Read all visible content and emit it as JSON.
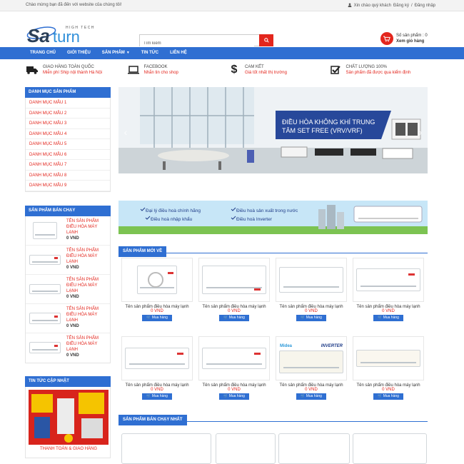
{
  "topbar": {
    "welcome": "Chào mừng bạn đã đến với website của chúng tôi!",
    "greeting": "Xin chào quý khách",
    "register": "Đăng ký",
    "separator": "/",
    "login": "Đăng nhập"
  },
  "header": {
    "logo_text": "Saturn",
    "logo_tagline": "HIGH TECH",
    "search_placeholder": "Tìm kiếm",
    "cart_count_label": "Số sản phẩm : 0",
    "cart_view": "Xem giỏ hàng"
  },
  "nav": {
    "items": [
      "TRANG CHỦ",
      "GIỚI THIỆU",
      "SẢN PHẨM",
      "TIN TỨC",
      "LIÊN HỆ"
    ]
  },
  "features": [
    {
      "title": "GIAO HÀNG TOÀN QUỐC",
      "sub": "Miễn phí Ship nội thành Hà Nội",
      "icon": "truck-icon"
    },
    {
      "title": "FACEBOOK",
      "sub": "Nhắn tin cho shop",
      "icon": "laptop-icon"
    },
    {
      "title": "CAM KẾT",
      "sub": "Giá tốt nhất thị trường",
      "icon": "dollar-icon"
    },
    {
      "title": "CHẤT LƯỢNG 100%",
      "sub": "Sản phẩm đã được qua kiểm định",
      "icon": "checkbox-icon"
    }
  ],
  "sidebar": {
    "categories_title": "DANH MỤC SẢN PHẨM",
    "categories": [
      "DANH MỤC MẪU 1",
      "DANH MỤC MẪU 2",
      "DANH MỤC MẪU 3",
      "DANH MỤC MẪU 4",
      "DANH MỤC MẪU 5",
      "DANH MỤC MẪU 6",
      "DANH MỤC MẪU 7",
      "DANH MỤC MẪU 8",
      "DANH MỤC MẪU 9"
    ],
    "bestseller_title": "SẢN PHẨM BÁN CHẠY",
    "bestsellers": [
      {
        "name": "TÊN SẢN PHẨM ĐIỀU HÒA MÁY LẠNH",
        "price": "0 VND"
      },
      {
        "name": "TÊN SẢN PHẨM ĐIỀU HÒA MÁY LẠNH",
        "price": "0 VND"
      },
      {
        "name": "TÊN SẢN PHẨM ĐIỀU HÒA MÁY LẠNH",
        "price": "0 VND"
      },
      {
        "name": "TÊN SẢN PHẨM ĐIỀU HÒA MÁY LẠNH",
        "price": "0 VND"
      },
      {
        "name": "TÊN SẢN PHẨM ĐIỀU HÒA MÁY LẠNH",
        "price": "0 VND"
      }
    ],
    "news_title": "TIN TỨC CẬP NHẬT",
    "news_caption": "THANH TOÁN & GIAO HÀNG"
  },
  "slider": {
    "caption_line1": "ĐIỀU HÒA KHÔNG KHÍ TRUNG",
    "caption_line2": "TÂM SET FREE (VRV/VRF)"
  },
  "banner2": {
    "items": [
      "Đại lý điều hoà chính hãng",
      "Điều hoà sản xuất trong nước",
      "Điều hoà nhập khẩu",
      "Điều hoà Inverter"
    ]
  },
  "sections": {
    "new_products": "SẢN PHẨM MỚI VỀ",
    "best_sellers": "SẢN PHẨM BÁN CHẠY NHẤT"
  },
  "products": [
    {
      "name": "Tên sản phẩm điều hòa máy lạnh",
      "price": "0 VND",
      "buy": "Mua hàng"
    },
    {
      "name": "Tên sản phẩm điều hòa máy lạnh",
      "price": "0 VND",
      "buy": "Mua hàng"
    },
    {
      "name": "Tên sản phẩm điều hòa máy lạnh",
      "price": "0 VND",
      "buy": "Mua hàng"
    },
    {
      "name": "Tên sản phẩm điều hòa máy lạnh",
      "price": "0 VND",
      "buy": "Mua hàng"
    },
    {
      "name": "Tên sản phẩm điều hòa máy lạnh",
      "price": "0 VND",
      "buy": "Mua hàng"
    },
    {
      "name": "Tên sản phẩm điều hòa máy lạnh",
      "price": "0 VND",
      "buy": "Mua hàng"
    },
    {
      "name": "Tên sản phẩm điều hòa máy lạnh",
      "price": "0 VND",
      "buy": "Mua hàng"
    },
    {
      "name": "Tên sản phẩm điều hòa máy lạnh",
      "price": "0 VND",
      "buy": "Mua hàng"
    }
  ],
  "product_brands": {
    "midea": "Midea",
    "inverter": "INVERTER"
  },
  "colors": {
    "primary": "#2f6fd2",
    "accent": "#e3261d"
  }
}
